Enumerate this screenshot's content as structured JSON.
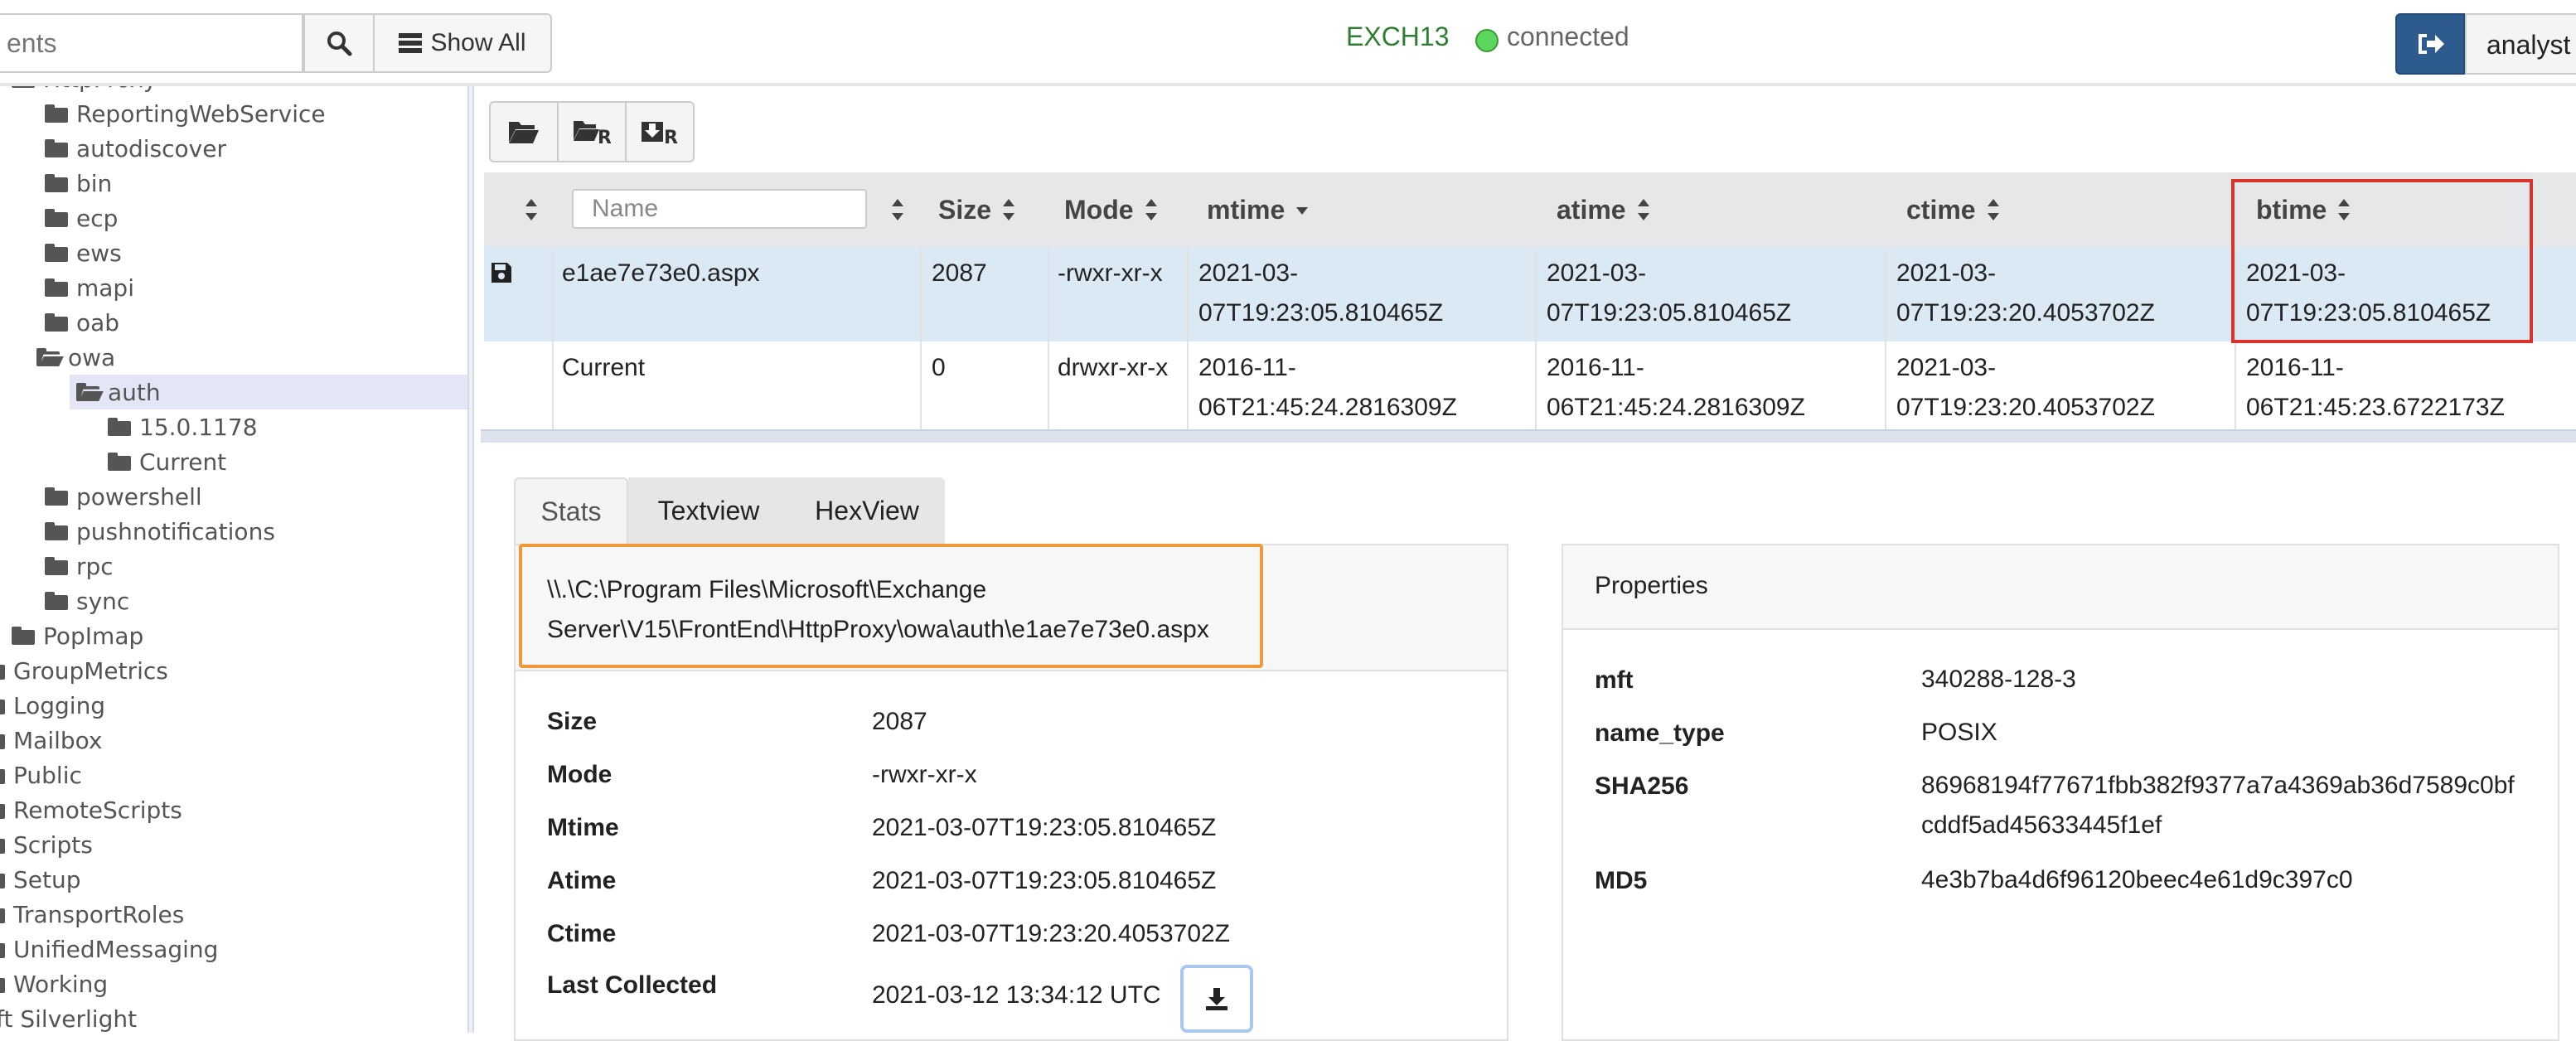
{
  "header": {
    "search_placeholder": "ents",
    "show_all_label": "Show All",
    "hostname": "EXCH13",
    "connection_status": "connected",
    "user": "analyst"
  },
  "sidebar": {
    "items": [
      {
        "label": "HttpProxy",
        "open": true
      },
      {
        "label": "ReportingWebService"
      },
      {
        "label": "autodiscover"
      },
      {
        "label": "bin"
      },
      {
        "label": "ecp"
      },
      {
        "label": "ews"
      },
      {
        "label": "mapi"
      },
      {
        "label": "oab"
      },
      {
        "label": "owa",
        "open": true
      },
      {
        "label": "auth",
        "open": true,
        "selected": true
      },
      {
        "label": "15.0.1178"
      },
      {
        "label": "Current"
      },
      {
        "label": "powershell"
      },
      {
        "label": "pushnotifications"
      },
      {
        "label": "rpc"
      },
      {
        "label": "sync"
      },
      {
        "label": "PopImap"
      },
      {
        "label": "GroupMetrics"
      },
      {
        "label": "Logging"
      },
      {
        "label": "Mailbox"
      },
      {
        "label": "Public"
      },
      {
        "label": "RemoteScripts"
      },
      {
        "label": "Scripts"
      },
      {
        "label": "Setup"
      },
      {
        "label": "TransportRoles"
      },
      {
        "label": "UnifiedMessaging"
      },
      {
        "label": "Working"
      },
      {
        "label": "oft Silverlight"
      }
    ]
  },
  "table": {
    "name_placeholder": "Name",
    "headers": {
      "size": "Size",
      "mode": "Mode",
      "mtime": "mtime",
      "atime": "atime",
      "ctime": "ctime",
      "btime": "btime"
    },
    "rows": [
      {
        "name": "e1ae7e73e0.aspx",
        "size": "2087",
        "mode": "-rwxr-xr-x",
        "mtime": [
          "2021-03-",
          "07T19:23:05.810465Z"
        ],
        "atime": [
          "2021-03-",
          "07T19:23:05.810465Z"
        ],
        "ctime": [
          "2021-03-",
          "07T19:23:20.4053702Z"
        ],
        "btime": [
          "2021-03-",
          "07T19:23:05.810465Z"
        ]
      },
      {
        "name": "Current",
        "size": "0",
        "mode": "drwxr-xr-x",
        "mtime": [
          "2016-11-",
          "06T21:45:24.2816309Z"
        ],
        "atime": [
          "2016-11-",
          "06T21:45:24.2816309Z"
        ],
        "ctime": [
          "2021-03-",
          "07T19:23:20.4053702Z"
        ],
        "btime": [
          "2016-11-",
          "06T21:45:23.6722173Z"
        ]
      }
    ]
  },
  "tabs": {
    "stats": "Stats",
    "textview": "Textview",
    "hexview": "HexView"
  },
  "stats": {
    "path_line1": "\\\\.\\C:\\Program Files\\Microsoft\\Exchange",
    "path_line2": "Server\\V15\\FrontEnd\\HttpProxy\\owa\\auth\\e1ae7e73e0.aspx",
    "fields": [
      {
        "k": "Size",
        "v": "2087"
      },
      {
        "k": "Mode",
        "v": "-rwxr-xr-x"
      },
      {
        "k": "Mtime",
        "v": "2021-03-07T19:23:05.810465Z"
      },
      {
        "k": "Atime",
        "v": "2021-03-07T19:23:05.810465Z"
      },
      {
        "k": "Ctime",
        "v": "2021-03-07T19:23:20.4053702Z"
      },
      {
        "k": "Last Collected",
        "v": "2021-03-12 13:34:12 UTC"
      }
    ]
  },
  "properties": {
    "title": "Properties",
    "fields": [
      {
        "k": "mft",
        "v": "340288-128-3"
      },
      {
        "k": "name_type",
        "v": "POSIX"
      },
      {
        "k": "SHA256",
        "v": "86968194f77671fbb382f9377a7a4369ab36d7589c0bfcddf5ad45633445f1ef"
      },
      {
        "k": "MD5",
        "v": "4e3b7ba4d6f96120beec4e61d9c397c0"
      }
    ]
  },
  "colors": {
    "accent": "#2d5b8e",
    "connected": "#5cd65c",
    "highlight_red": "#d9342b",
    "highlight_orange": "#ef9a3a"
  }
}
